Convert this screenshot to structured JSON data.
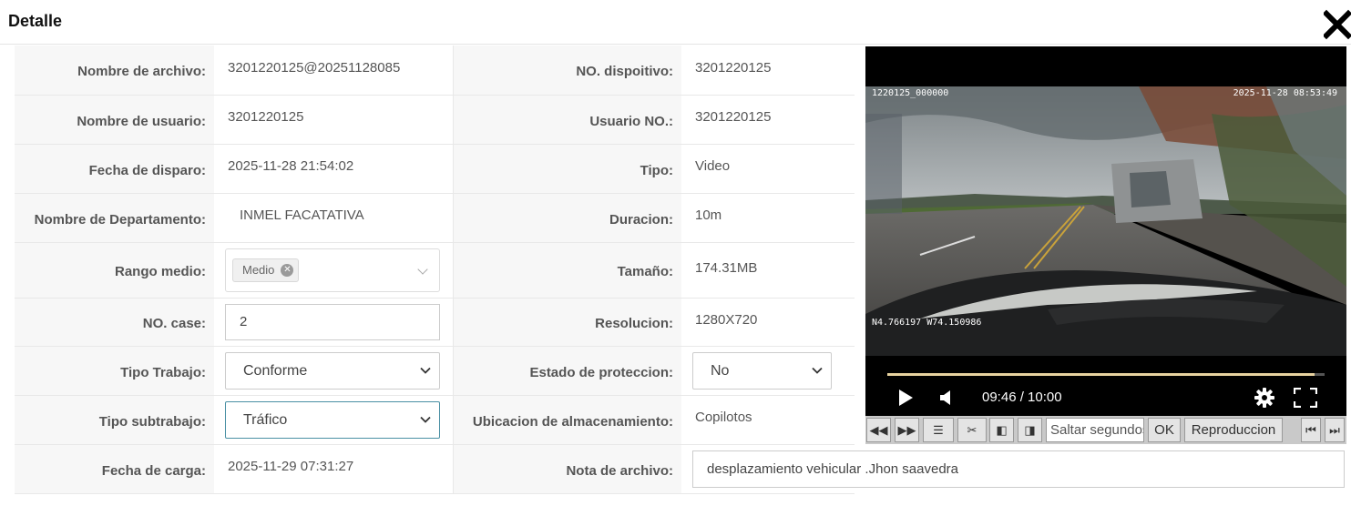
{
  "header": {
    "title": "Detalle"
  },
  "fields": {
    "nombre_archivo": {
      "label": "Nombre de archivo:",
      "value": "3201220125@20251128085"
    },
    "no_dispositivo": {
      "label": "NO. dispoitivo:",
      "value": "3201220125"
    },
    "nombre_usuario": {
      "label": "Nombre de usuario:",
      "value": "3201220125"
    },
    "usuario_no": {
      "label": "Usuario NO.:",
      "value": "3201220125"
    },
    "fecha_disparo": {
      "label": "Fecha de disparo:",
      "value": "2025-11-28 21:54:02"
    },
    "tipo": {
      "label": "Tipo:",
      "value": "Video"
    },
    "nombre_departamento": {
      "label": "Nombre de Departamento:",
      "value": "INMEL FACATATIVA"
    },
    "duracion": {
      "label": "Duracion:",
      "value": "10m"
    },
    "rango_medio": {
      "label": "Rango medio:",
      "tag": "Medio"
    },
    "tamano": {
      "label": "Tamaño:",
      "value": "174.31MB"
    },
    "no_case": {
      "label": "NO. case:",
      "value": "2"
    },
    "resolucion": {
      "label": "Resolucion:",
      "value": "1280X720"
    },
    "tipo_trabajo": {
      "label": "Tipo Trabajo:",
      "value": "Conforme"
    },
    "estado_proteccion": {
      "label": "Estado de proteccion:",
      "value": "No"
    },
    "tipo_subtrabajo": {
      "label": "Tipo subtrabajo:",
      "value": "Tráfico"
    },
    "ubicacion": {
      "label": "Ubicacion de almacenamiento:",
      "value": "Copilotos"
    },
    "fecha_carga": {
      "label": "Fecha de carga:",
      "value": "2025-11-29 07:31:27"
    },
    "nota": {
      "label": "Nota de archivo:",
      "value": "desplazamiento vehicular .Jhon saavedra"
    }
  },
  "video": {
    "overlay_left": "1220125_000000",
    "overlay_right": "2025-11-28 08:53:49",
    "overlay_gps": "N4.766197 W74.150986",
    "time": "09:46 / 10:00",
    "progress": 0.977
  },
  "toolbar": {
    "seek_placeholder": "Saltar segundos",
    "ok_label": "OK",
    "play_label": "Reproduccion"
  },
  "colors": {
    "progress": "#e8d3a0",
    "focus_border": "#4a90a4"
  }
}
